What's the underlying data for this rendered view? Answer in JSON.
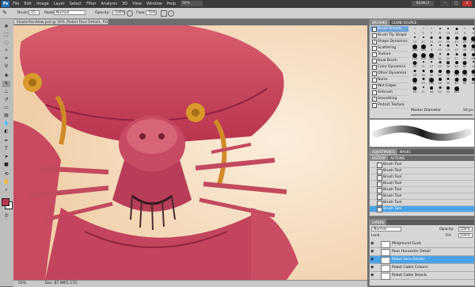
{
  "menubar": {
    "logo": "Ps",
    "menus": [
      "File",
      "Edit",
      "Image",
      "Layer",
      "Select",
      "Filter",
      "Analysis",
      "3D",
      "View",
      "Window",
      "Help"
    ],
    "zoom": "50%",
    "workspace": "BEING2",
    "window_buttons": [
      "-",
      "□",
      "x"
    ]
  },
  "options_bar": {
    "brush_label": "Brush:",
    "brush_size": "15",
    "mode_label": "Mode:",
    "mode_value": "Normal",
    "opacity_label": "Opacity:",
    "opacity_value": "100%",
    "flow_label": "Flow:",
    "flow_value": "70%"
  },
  "document": {
    "tab_title": "Illusterfainitlow.psd @ 50% (Robot Face Details, RGB/8)",
    "status": "Doc: 87.9M/1.17G"
  },
  "brushes_panel": {
    "tabs": [
      "BRUSHES",
      "CLONE SOURCE"
    ],
    "items": [
      {
        "label": "Brush Presets",
        "checked": false,
        "selected": true
      },
      {
        "label": "Brush Tip Shape",
        "checked": false,
        "selected": false
      },
      {
        "label": "Shape Dynamics",
        "checked": true,
        "selected": false
      },
      {
        "label": "Scattering",
        "checked": false,
        "selected": false
      },
      {
        "label": "Texture",
        "checked": false,
        "selected": false
      },
      {
        "label": "Dual Brush",
        "checked": false,
        "selected": false
      },
      {
        "label": "Color Dynamics",
        "checked": false,
        "selected": false
      },
      {
        "label": "Other Dynamics",
        "checked": true,
        "selected": false
      },
      {
        "label": "Noise",
        "checked": false,
        "selected": false
      },
      {
        "label": "Wet Edges",
        "checked": false,
        "selected": false
      },
      {
        "label": "Airbrush",
        "checked": false,
        "selected": false
      },
      {
        "label": "Smoothing",
        "checked": true,
        "selected": false
      },
      {
        "label": "Protect Texture",
        "checked": false,
        "selected": false
      }
    ],
    "tips": [
      "1",
      "3",
      "5",
      "9",
      "13",
      "19",
      "5",
      "9",
      "13",
      "17",
      "21",
      "27",
      "35",
      "45",
      "65",
      "100",
      "200",
      "300",
      "9",
      "13",
      "19",
      "17",
      "45",
      "65",
      "100",
      "200",
      "300",
      "14",
      "24",
      "27",
      "39",
      "46",
      "59",
      "11",
      "17",
      "23",
      "36",
      "44",
      "60",
      "14",
      "26",
      "33",
      "42",
      "55",
      "70",
      "112",
      "134",
      "74",
      "95",
      "29",
      "192",
      "36",
      "33",
      "63",
      "66",
      "39",
      "63",
      "11",
      "48",
      "32",
      "55",
      "100"
    ],
    "master_diameter_label": "Master Diameter",
    "master_diameter_value": "50 px"
  },
  "history_panel": {
    "tabs": [
      "ADJUSTMENTS",
      "MASKS"
    ],
    "subtabs": [
      "HISTORY",
      "ACTIONS"
    ],
    "items": [
      "Brush Tool",
      "Brush Tool",
      "Brush Tool",
      "Brush Tool",
      "Brush Tool",
      "Brush Tool",
      "Brush Tool",
      "Brush Tool"
    ],
    "selected_index": 7
  },
  "layers_panel": {
    "tabs": [
      "LAYERS"
    ],
    "blend_mode": "Normal",
    "opacity_label": "Opacity:",
    "opacity_value": "100%",
    "lock_label": "Lock:",
    "fill_label": "Fill:",
    "fill_value": "100%",
    "layers": [
      {
        "name": "Midground Gunk",
        "selected": false
      },
      {
        "name": "Rear Harvester Detail",
        "selected": false
      },
      {
        "name": "Robot Face Details",
        "selected": true
      },
      {
        "name": "Robot Cable Colours",
        "selected": false
      },
      {
        "name": "Robot Cable Details",
        "selected": false
      }
    ]
  }
}
